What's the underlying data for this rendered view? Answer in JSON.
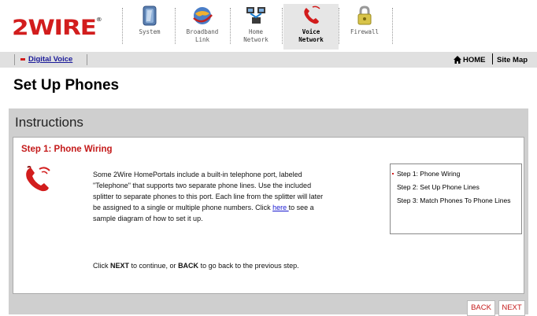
{
  "brand": {
    "logo_text": "2WIRE",
    "trademark": "®",
    "accent": "#d21d1d"
  },
  "nav": {
    "tabs": [
      {
        "label_line1": "System",
        "label_line2": "",
        "active": false
      },
      {
        "label_line1": "Broadband",
        "label_line2": "Link",
        "active": false
      },
      {
        "label_line1": "Home",
        "label_line2": "Network",
        "active": false
      },
      {
        "label_line1": "Voice",
        "label_line2": "Network",
        "active": true
      },
      {
        "label_line1": "Firewall",
        "label_line2": "",
        "active": false
      }
    ]
  },
  "subbar": {
    "section_link": "Digital Voice",
    "home_label": "HOME",
    "sitemap_label": "Site Map"
  },
  "page": {
    "title": "Set Up Phones"
  },
  "panel": {
    "heading": "Instructions",
    "step_title": "Step 1: Phone Wiring",
    "body_part1": "Some 2Wire HomePortals include a built-in telephone port, labeled \"Telephone\" that supports two separate phone lines. Use the included splitter to separate phones to this port. Each line from the splitter will later be assigned to a single or multiple phone numbers. Click ",
    "body_link": "here ",
    "body_part2": "to see a sample diagram of how to set it up.",
    "nav_part1": "Click ",
    "nav_next": "NEXT",
    "nav_part2": " to continue, or ",
    "nav_back": "BACK",
    "nav_part3": " to go back to the previous step."
  },
  "steps": [
    {
      "label": "Step 1: Phone Wiring",
      "current": true
    },
    {
      "label": "Step 2: Set Up Phone Lines",
      "current": false
    },
    {
      "label": "Step 3: Match Phones To Phone Lines",
      "current": false
    }
  ],
  "buttons": {
    "back": "BACK",
    "next": "NEXT"
  }
}
